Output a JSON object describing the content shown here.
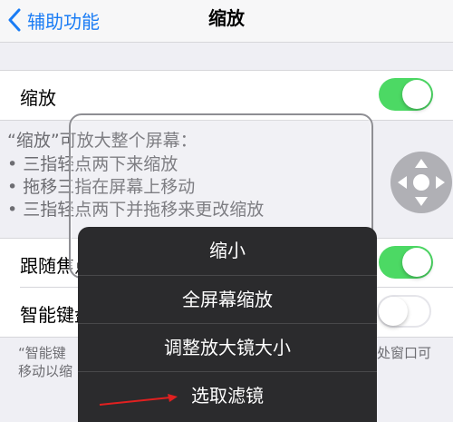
{
  "navbar": {
    "back_label": "辅助功能",
    "title": "缩放",
    "back_icon": "chevron-left-icon"
  },
  "zoom_row": {
    "label": "缩放",
    "switch_on": true
  },
  "description": {
    "heading": "“缩放”可放大整个屏幕：",
    "bullets": [
      "• 三指轻点两下来缩放",
      "• 拖移三指在屏幕上移动",
      "• 三指轻点两下并拖移来更改缩放"
    ]
  },
  "follow_focus_row": {
    "label": "跟随焦点",
    "switch_on": true
  },
  "smart_keyboard_row": {
    "label": "智能键盘",
    "switch_on": false
  },
  "footer": {
    "line1_left": "“智能键",
    "line1_right": "处窗口可",
    "line2_left": "移动以缩"
  },
  "zoom_menu": {
    "items": [
      "缩小",
      "全屏幕缩放",
      "调整放大镜大小",
      "选取滤镜"
    ]
  },
  "colors": {
    "accent": "#1a7cf5",
    "switch_on": "#4cd964",
    "menu_bg": "#2b2b2d",
    "annotation_arrow": "#e02020"
  },
  "icons": {
    "zoom_controller": "dpad-controller-icon",
    "annotation": "red-arrow-icon"
  }
}
